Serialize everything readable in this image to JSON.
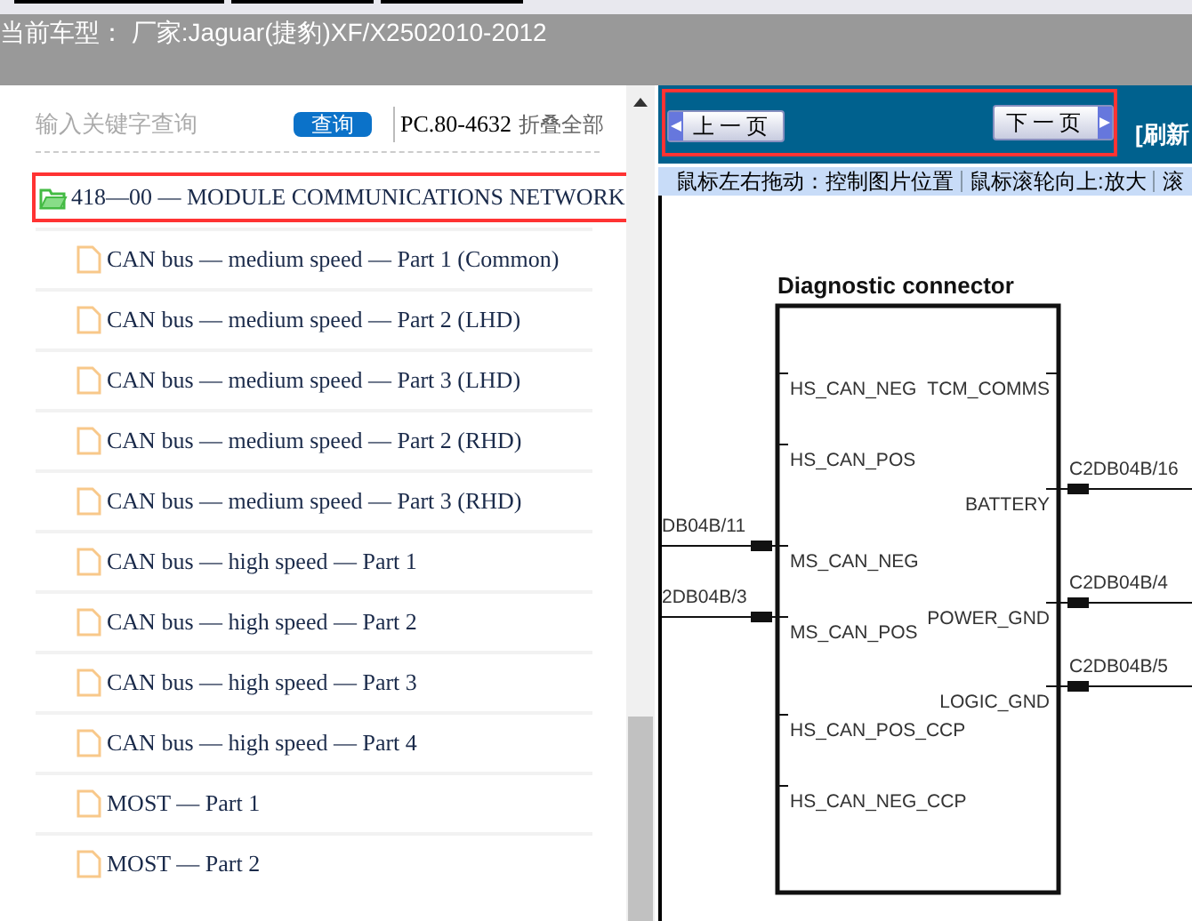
{
  "header": {
    "vehicle": "当前车型： 厂家:Jaguar(捷豹)XF/X2502010-2012"
  },
  "search": {
    "placeholder": "输入关键字查询",
    "button": "查询",
    "code": "PC.80-4632",
    "collapse_all": "折叠全部"
  },
  "tree": {
    "label": "418—00 — MODULE COMMUNICATIONS NETWORK",
    "expanded": true,
    "highlighted": true,
    "children": [
      {
        "label": "CAN bus — medium speed — Part 1 (Common)"
      },
      {
        "label": "CAN bus — medium speed — Part 2 (LHD)"
      },
      {
        "label": "CAN bus — medium speed — Part 3 (LHD)"
      },
      {
        "label": "CAN bus — medium speed — Part 2 (RHD)"
      },
      {
        "label": "CAN bus — medium speed — Part 3 (RHD)"
      },
      {
        "label": "CAN bus — high speed — Part 1"
      },
      {
        "label": "CAN bus — high speed — Part 2"
      },
      {
        "label": "CAN bus — high speed — Part 3"
      },
      {
        "label": "CAN bus — high speed — Part 4"
      },
      {
        "label": "MOST — Part 1"
      },
      {
        "label": "MOST — Part 2"
      }
    ]
  },
  "pager": {
    "highlighted": true,
    "previous": "上一页",
    "next": "下一页",
    "refresh": "[刷新"
  },
  "instructions": [
    "鼠标左右拖动：控制图片位置",
    "鼠标滚轮向上:放大",
    "滚"
  ],
  "diagram": {
    "title": "Diagnostic connector",
    "left_pins": [
      {
        "label": "HS_CAN_NEG"
      },
      {
        "label": "HS_CAN_POS"
      },
      {
        "label": "MS_CAN_NEG",
        "wire": "DB04B/11"
      },
      {
        "label": "MS_CAN_POS",
        "wire": "2DB04B/3"
      },
      {
        "label": "HS_CAN_POS_CCP"
      },
      {
        "label": "HS_CAN_NEG_CCP"
      }
    ],
    "right_pins": [
      {
        "label": "TCM_COMMS"
      },
      {
        "label": "BATTERY",
        "wire": "C2DB04B/16"
      },
      {
        "label": "POWER_GND",
        "wire": "C2DB04B/4"
      },
      {
        "label": "LOGIC_GND",
        "wire": "C2DB04B/5"
      }
    ]
  }
}
